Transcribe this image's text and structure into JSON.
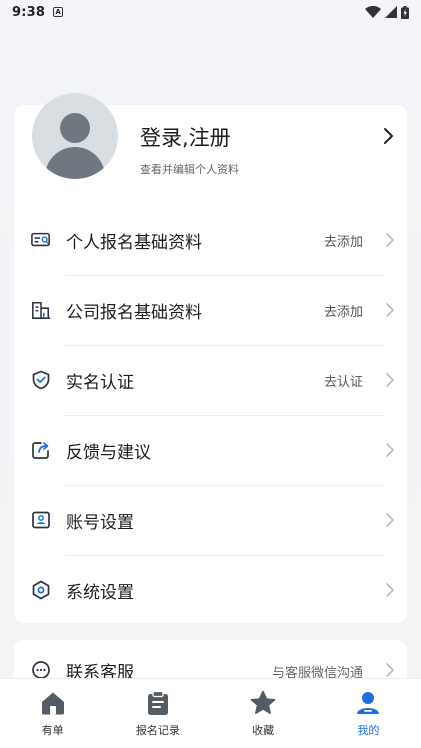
{
  "status": {
    "time": "9:38",
    "notif": "A"
  },
  "profile": {
    "title": "登录,注册",
    "subtitle": "查看并编辑个人资料"
  },
  "menu": [
    {
      "label": "个人报名基础资料",
      "value": "去添加",
      "icon": "id-card-icon"
    },
    {
      "label": "公司报名基础资料",
      "value": "去添加",
      "icon": "building-icon"
    },
    {
      "label": "实名认证",
      "value": "去认证",
      "icon": "shield-check-icon"
    },
    {
      "label": "反馈与建议",
      "value": "",
      "icon": "share-edit-icon"
    },
    {
      "label": "账号设置",
      "value": "",
      "icon": "user-badge-icon"
    },
    {
      "label": "系统设置",
      "value": "",
      "icon": "settings-hex-icon"
    }
  ],
  "contact": {
    "label": "联系客服",
    "value": "与客服微信沟通"
  },
  "tabs": [
    {
      "label": "有单",
      "icon": "home-icon"
    },
    {
      "label": "报名记录",
      "icon": "clipboard-icon"
    },
    {
      "label": "收藏",
      "icon": "star-icon"
    },
    {
      "label": "我的",
      "icon": "person-icon"
    }
  ],
  "colors": {
    "accent": "#1d6fe0",
    "icon": "#2b3442",
    "tab_inactive": "#555b63"
  }
}
